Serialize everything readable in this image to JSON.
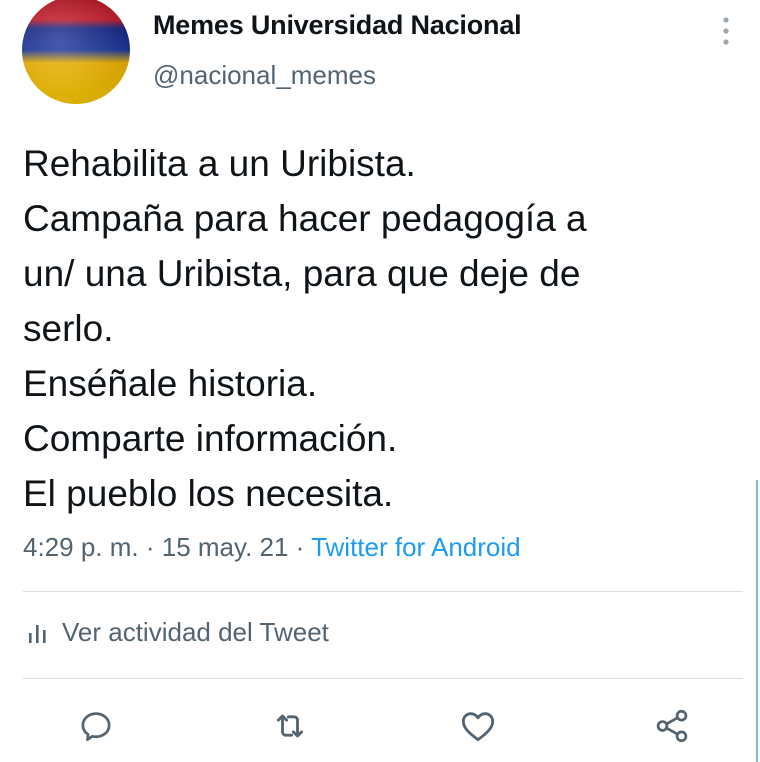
{
  "author": {
    "display_name": "Memes Universidad Nacional",
    "handle": "@nacional_memes",
    "avatar_icon": "flag-avatar"
  },
  "tweet": {
    "lines": [
      "Rehabilita a un Uribista.",
      "Campaña para hacer pedagogía a",
      "un/ una Uribista, para que deje de",
      "serlo.",
      "Enséñale historia.",
      "Comparte información.",
      "El pueblo los necesita."
    ],
    "time": "4:29 p. m.",
    "separator": " · ",
    "date": "15 may. 21",
    "source": "Twitter for Android"
  },
  "activity": {
    "label": "Ver actividad del Tweet",
    "icon": "bar-chart-icon"
  },
  "actions": {
    "reply_icon": "reply-icon",
    "retweet_icon": "retweet-icon",
    "like_icon": "heart-icon",
    "share_icon": "share-icon"
  },
  "colors": {
    "text": "#0f1419",
    "secondary": "#536471",
    "link": "#1d9bf0"
  }
}
